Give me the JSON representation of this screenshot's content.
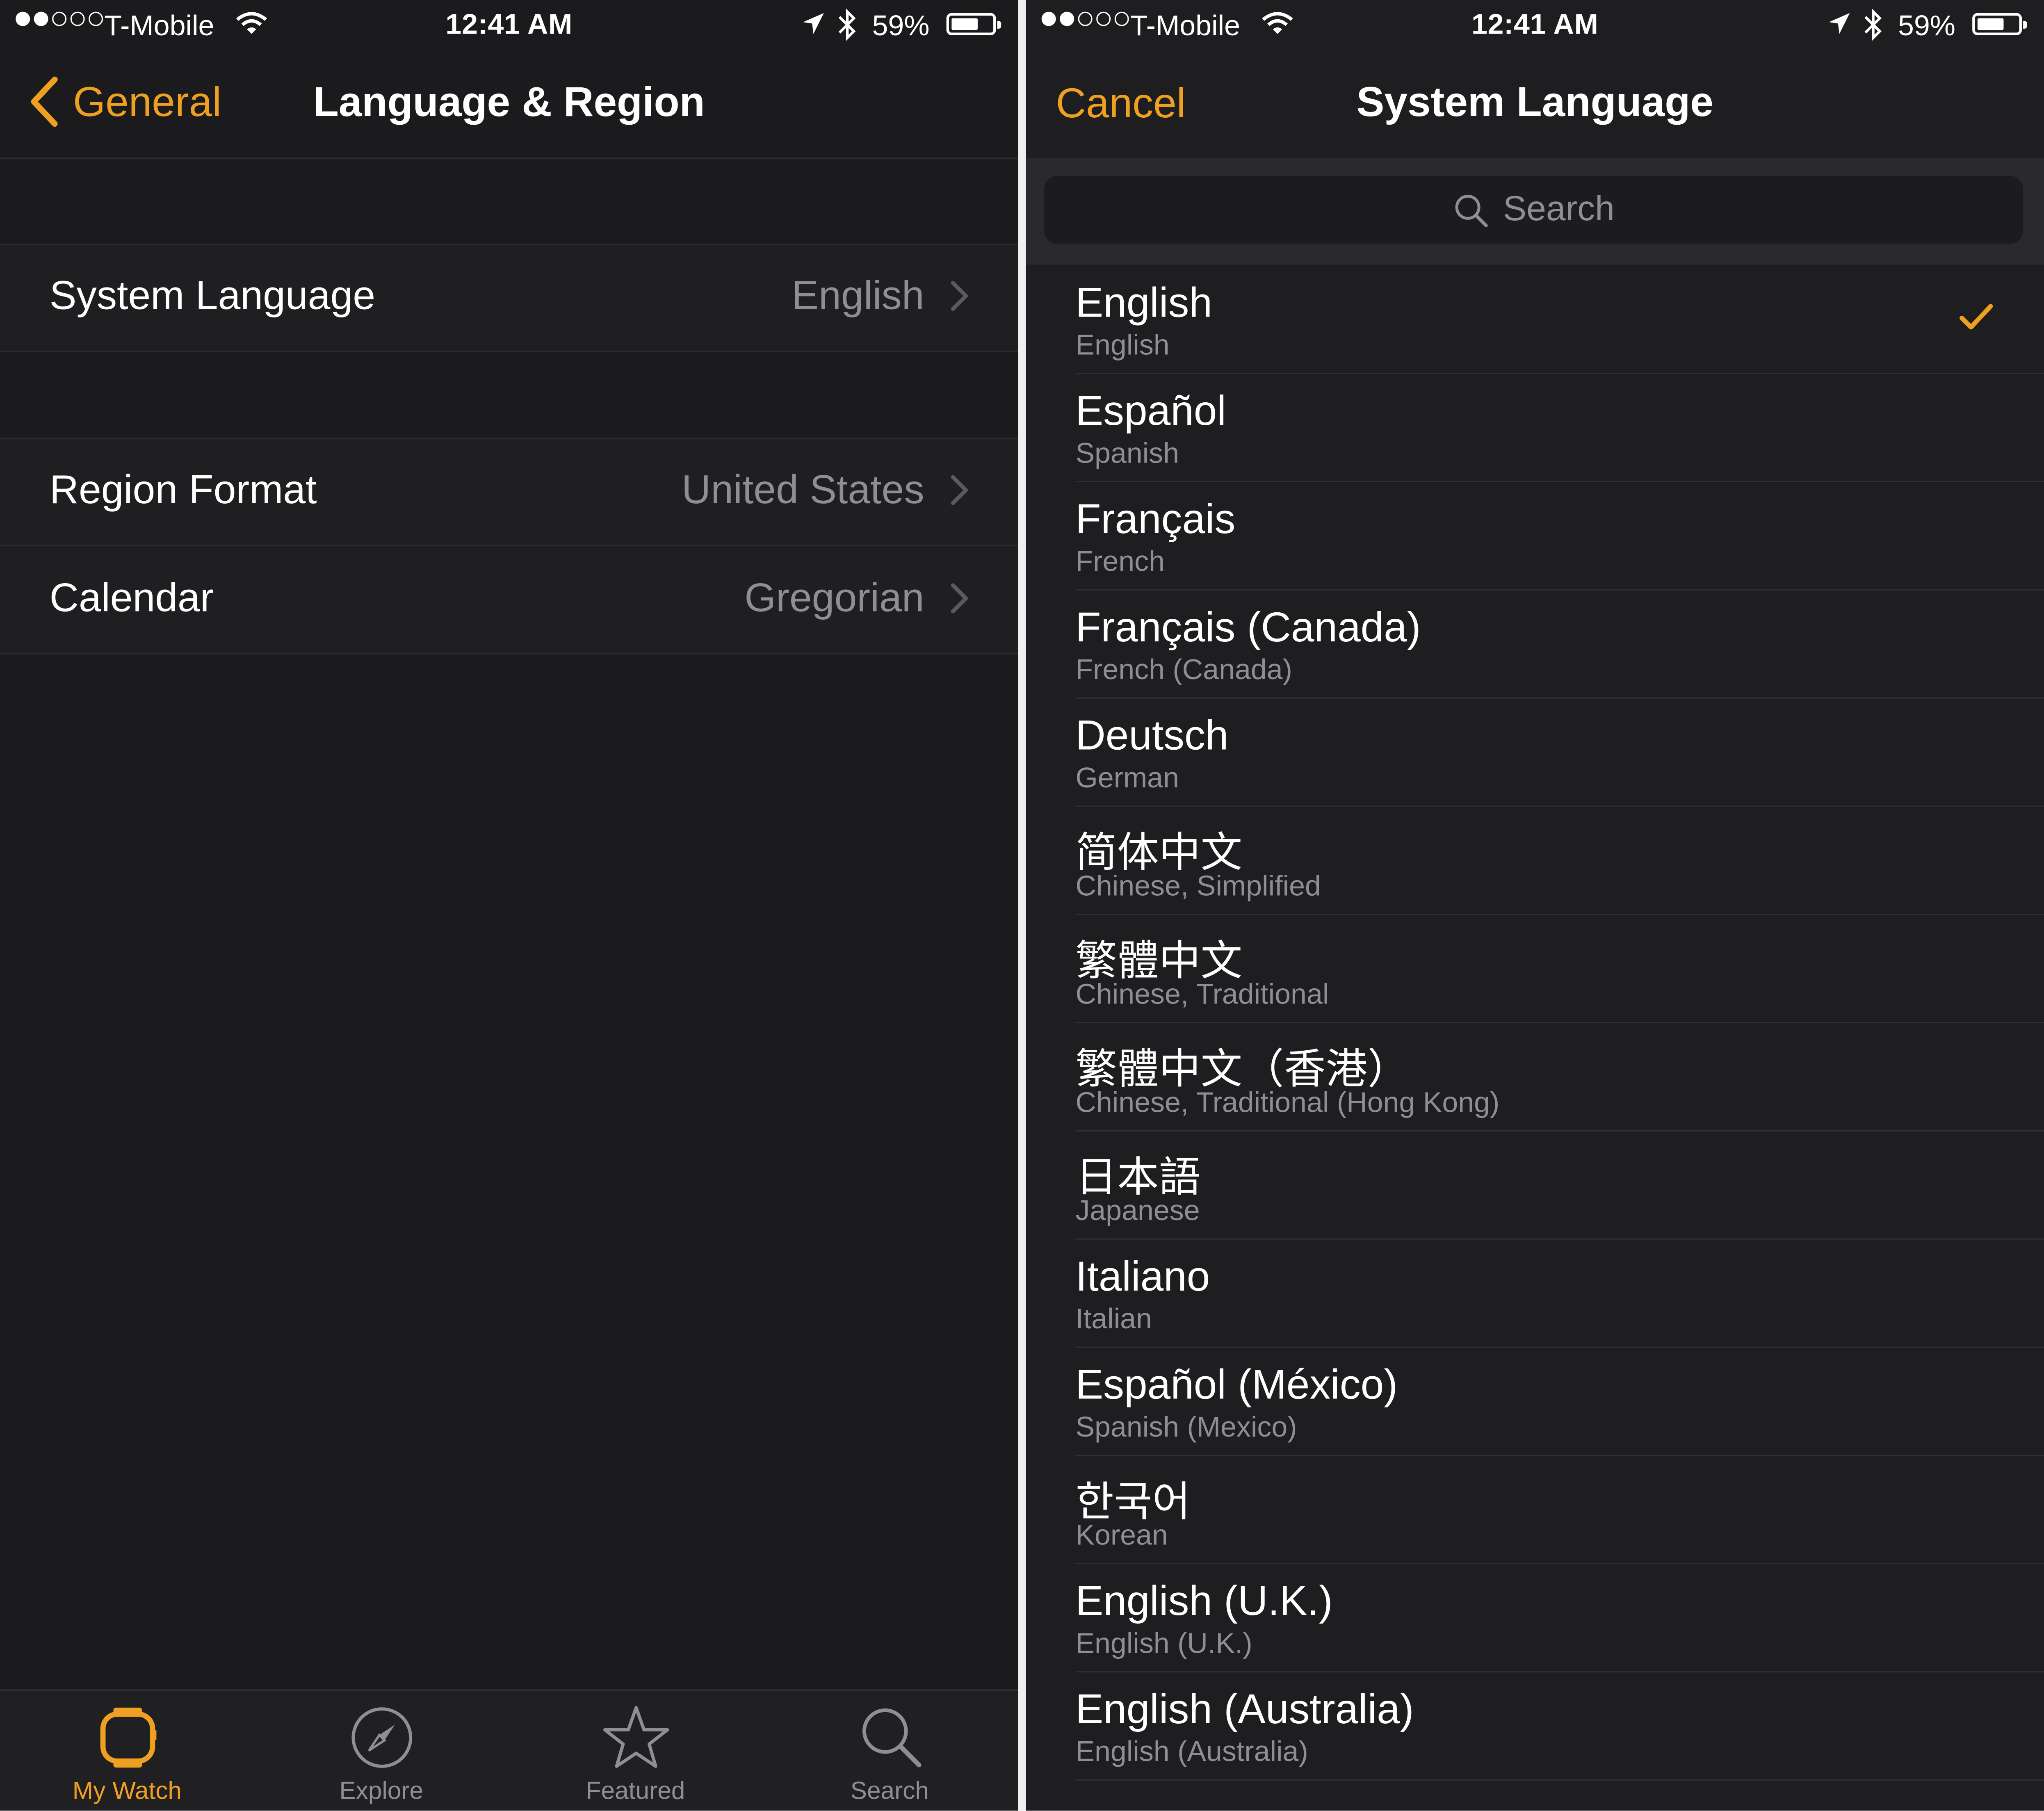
{
  "status_bar": {
    "carrier": "T-Mobile",
    "time": "12:41 AM",
    "battery": "59%",
    "battery_level": 0.59,
    "signal_bars": 2,
    "signal_total": 5
  },
  "left": {
    "nav": {
      "back_label": "General",
      "title": "Language & Region"
    },
    "settings": [
      {
        "label": "System Language",
        "value": "English"
      },
      {
        "label": "Region Format",
        "value": "United States"
      },
      {
        "label": "Calendar",
        "value": "Gregorian"
      }
    ],
    "tabs": [
      {
        "label": "My Watch",
        "icon": "watch-icon",
        "active": true
      },
      {
        "label": "Explore",
        "icon": "compass-icon",
        "active": false
      },
      {
        "label": "Featured",
        "icon": "star-icon",
        "active": false
      },
      {
        "label": "Search",
        "icon": "search-icon",
        "active": false
      }
    ]
  },
  "right": {
    "nav": {
      "cancel_label": "Cancel",
      "title": "System Language"
    },
    "search": {
      "placeholder": "Search"
    },
    "languages": [
      {
        "name": "English",
        "english": "English",
        "selected": true
      },
      {
        "name": "Español",
        "english": "Spanish"
      },
      {
        "name": "Français",
        "english": "French"
      },
      {
        "name": "Français (Canada)",
        "english": "French (Canada)"
      },
      {
        "name": "Deutsch",
        "english": "German"
      },
      {
        "name": "简体中文",
        "english": "Chinese, Simplified"
      },
      {
        "name": "繁體中文",
        "english": "Chinese, Traditional"
      },
      {
        "name": "繁體中文（香港）",
        "english": "Chinese, Traditional (Hong Kong)"
      },
      {
        "name": "日本語",
        "english": "Japanese"
      },
      {
        "name": "Italiano",
        "english": "Italian"
      },
      {
        "name": "Español (México)",
        "english": "Spanish (Mexico)"
      },
      {
        "name": "한국어",
        "english": "Korean"
      },
      {
        "name": "English (U.K.)",
        "english": "English (U.K.)"
      },
      {
        "name": "English (Australia)",
        "english": "English (Australia)"
      }
    ]
  },
  "colors": {
    "accent": "#f0a020",
    "background": "#1b1b1d",
    "secondary_text": "#8e8e93"
  }
}
